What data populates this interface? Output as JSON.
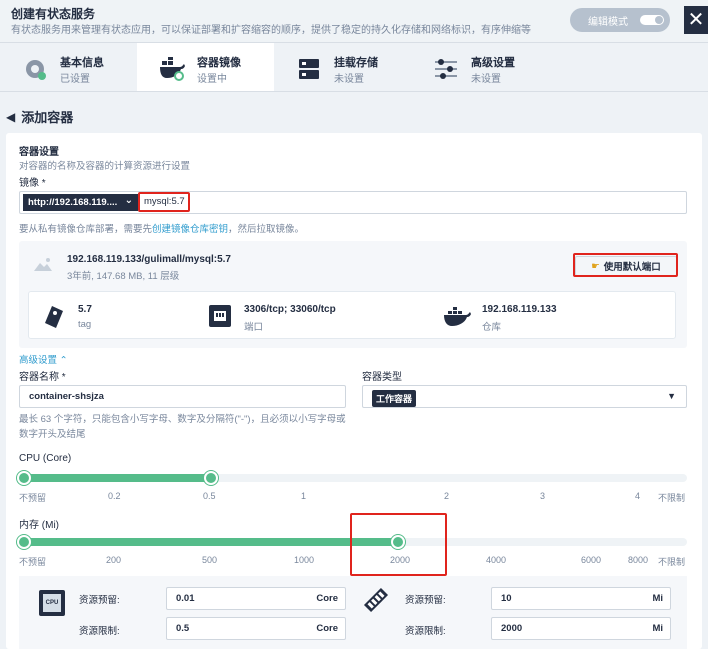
{
  "header": {
    "title": "创建有状态服务",
    "description": "有状态服务用来管理有状态应用，可以保证部署和扩容缩容的顺序，提供了稳定的持久化存储和网络标识，有序伸缩等",
    "edit_mode_label": "编辑模式"
  },
  "steps": [
    {
      "title": "基本信息",
      "status": "已设置"
    },
    {
      "title": "容器镜像",
      "status": "设置中"
    },
    {
      "title": "挂载存储",
      "status": "未设置"
    },
    {
      "title": "高级设置",
      "status": "未设置"
    }
  ],
  "page": {
    "back_title": "添加容器"
  },
  "container_settings": {
    "title": "容器设置",
    "desc": "对容器的名称及容器的计算资源进行设置",
    "image_label": "镜像 *",
    "registry": "http://192.168.119....",
    "image_value": "mysql:5.7",
    "hint_prefix": "要从私有镜像仓库部署，需要先",
    "hint_link": "创建镜像仓库密钥",
    "hint_suffix": "，然后拉取镜像。"
  },
  "image_card": {
    "name": "192.168.119.133/gulimall/mysql:5.7",
    "meta": "3年前, 147.68 MB, 11 层级",
    "default_port_button": "使用默认端口",
    "tag_value": "5.7",
    "tag_label": "tag",
    "ports_value": "3306/tcp; 33060/tcp",
    "ports_label": "端口",
    "repo_value": "192.168.119.133",
    "repo_label": "仓库"
  },
  "advanced": {
    "toggle_label": "高级设置",
    "name_label": "容器名称 *",
    "name_value": "container-shsjza",
    "type_label": "容器类型",
    "type_value": "工作容器",
    "name_hint": "最长 63 个字符，只能包含小写字母、数字及分隔符(\"-\")，且必须以小写字母或数字开头及结尾"
  },
  "cpu": {
    "label": "CPU (Core)",
    "ticks": [
      "不预留",
      "0.2",
      "0.5",
      "1",
      "2",
      "3",
      "4",
      "不限制"
    ],
    "reserve_fraction": 0,
    "limit_fraction": 0.29
  },
  "memory": {
    "label": "内存 (Mi)",
    "ticks": [
      "不预留",
      "200",
      "500",
      "1000",
      "2000",
      "4000",
      "6000",
      "8000",
      "不限制"
    ],
    "reserve_fraction": 0,
    "limit_fraction": 0.57
  },
  "resources": {
    "cpu_icon_label": "CPU",
    "reserve_label": "资源预留:",
    "limit_label": "资源限制:",
    "cpu_reserve": "0.01",
    "cpu_limit": "0.5",
    "cpu_unit": "Core",
    "mem_reserve": "10",
    "mem_limit": "2000",
    "mem_unit": "Mi"
  },
  "colors": {
    "accent": "#55bc8a",
    "dark": "#242e42",
    "highlight": "#e0241d",
    "link": "#329dce"
  }
}
